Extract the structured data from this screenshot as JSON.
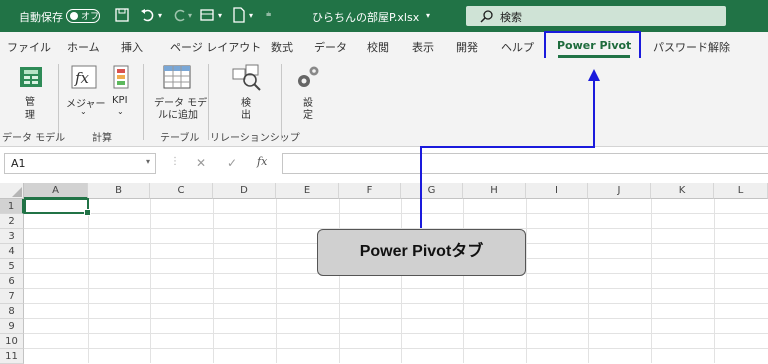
{
  "titlebar": {
    "autosave_label": "自動保存",
    "autosave_state": "オフ",
    "filename": "ひらちんの部屋P.xlsx",
    "search_placeholder": "検索"
  },
  "tabs": [
    "ファイル",
    "ホーム",
    "挿入",
    "ページ レイアウト",
    "数式",
    "データ",
    "校閲",
    "表示",
    "開発",
    "ヘルプ",
    "Power Pivot",
    "パスワード解除"
  ],
  "active_tab": "Power Pivot",
  "ribbon": {
    "manage_label": [
      "管",
      "理"
    ],
    "measures_label": "メジャー",
    "kpi_label": "KPI",
    "add_to_model_label": [
      "データ モデ",
      "ルに追加"
    ],
    "detect_label": [
      "検",
      "出"
    ],
    "settings_label": [
      "設",
      "定"
    ],
    "groups": [
      "データ モデル",
      "計算",
      "テーブル",
      "リレーションシップ"
    ]
  },
  "formula_bar": {
    "name_box": "A1",
    "fx": "fx",
    "content": ""
  },
  "grid": {
    "columns": [
      "A",
      "B",
      "C",
      "D",
      "E",
      "F",
      "G",
      "H",
      "I",
      "J",
      "K",
      "L"
    ],
    "rows": [
      "1",
      "2",
      "3",
      "4",
      "5",
      "6",
      "7",
      "8",
      "9",
      "10",
      "11"
    ],
    "selected_cell": "A1"
  },
  "callout": {
    "text": "Power Pivotタブ"
  },
  "colors": {
    "excel_green": "#217346",
    "highlight_blue": "#1a1adc",
    "arrow_blue": "#1a1adc"
  }
}
